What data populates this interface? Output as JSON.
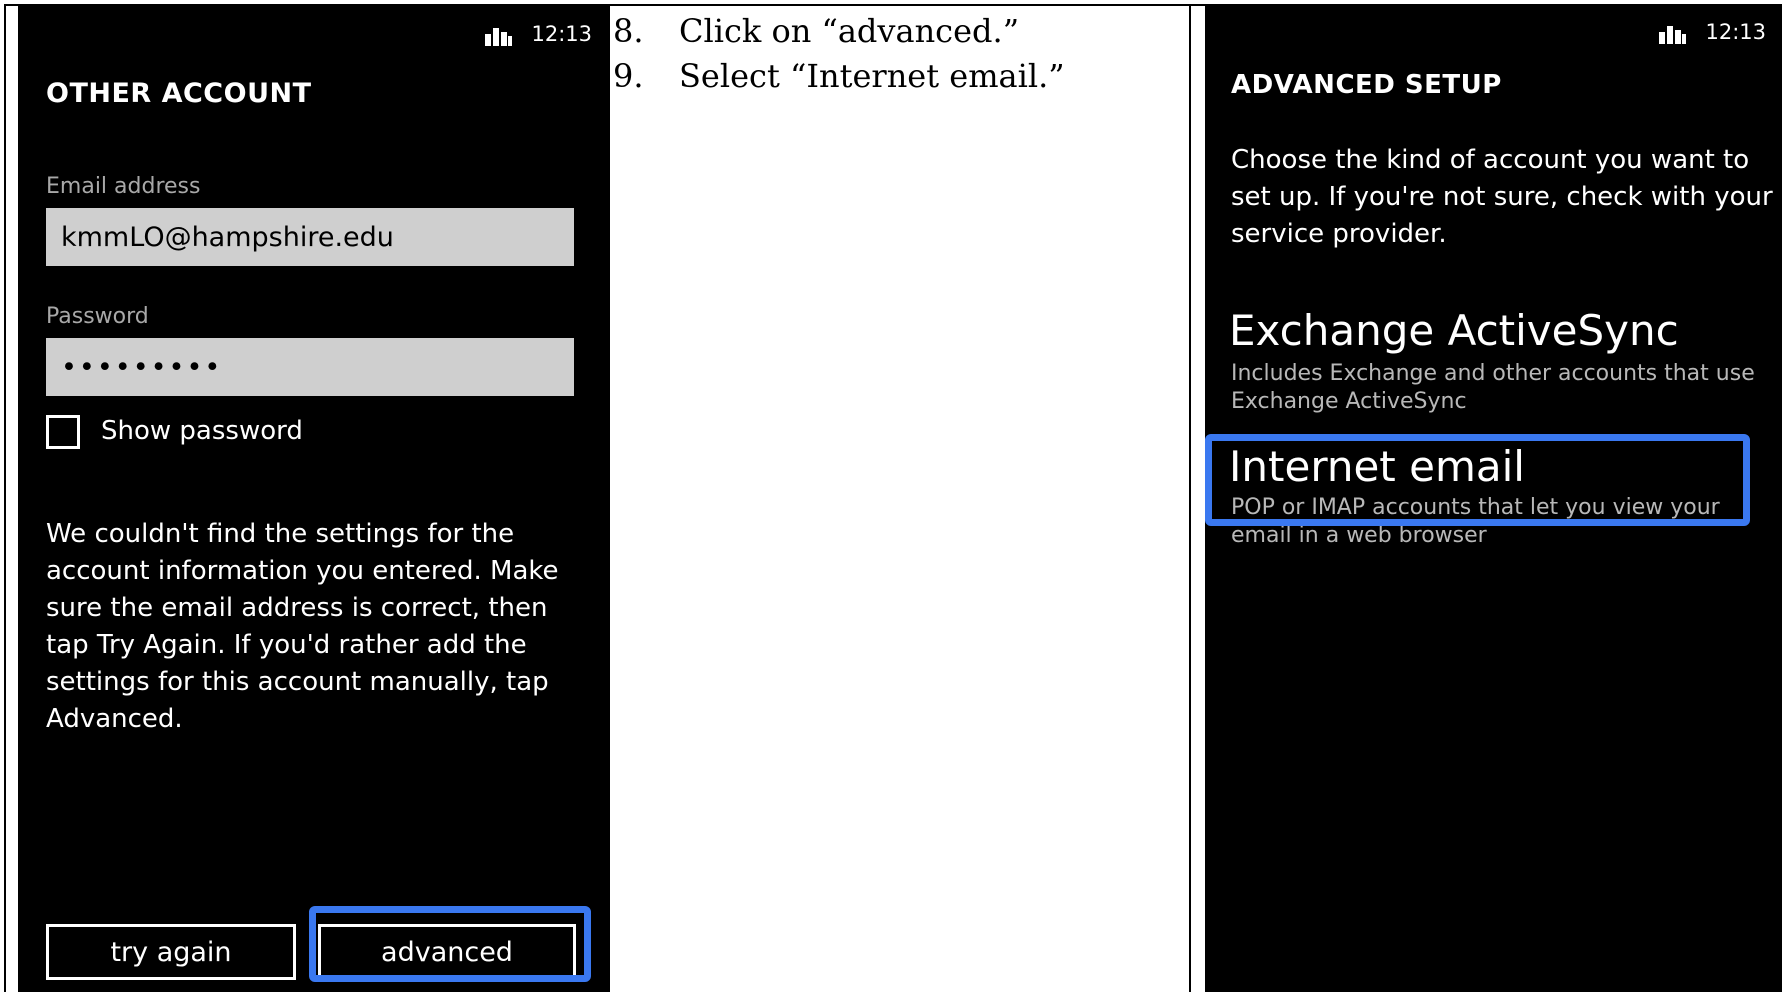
{
  "left_screen": {
    "status_time": "12:13",
    "title": "OTHER ACCOUNT",
    "email_label": "Email address",
    "email_value": "kmmLO@hampshire.edu",
    "password_label": "Password",
    "password_value": "•••••••••",
    "show_password_label": "Show password",
    "message": "We couldn't find the settings for the account information you entered. Make sure the email address is correct, then tap Try Again. If you'd rather add the settings for this account manually, tap Advanced.",
    "try_again_label": "try again",
    "advanced_label": "advanced"
  },
  "instructions": [
    {
      "num": "8.",
      "text": "Click on “advanced.”"
    },
    {
      "num": "9.",
      "text": "Select “Internet email.”"
    }
  ],
  "right_screen": {
    "status_time": "12:13",
    "title": "ADVANCED SETUP",
    "description": "Choose the kind of account you want to set up. If you're not sure, check with your service provider.",
    "options": [
      {
        "title": "Exchange ActiveSync",
        "subtitle": "Includes Exchange and other accounts that use Exchange ActiveSync"
      },
      {
        "title": "Internet email",
        "subtitle": "POP or IMAP accounts that let you view your email in a web browser"
      }
    ]
  },
  "colors": {
    "highlight": "#3a78f0",
    "field": "#cfcfcf",
    "screen_bg": "#000000"
  }
}
